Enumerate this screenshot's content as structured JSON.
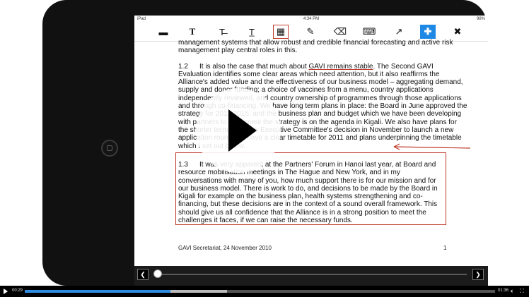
{
  "status": {
    "carrier": "iPad",
    "time": "4:34 PM",
    "battery": "98%"
  },
  "toolbar": {
    "tools": [
      {
        "name": "comment",
        "glyph": "▬",
        "icon": "comment-icon"
      },
      {
        "name": "text-box",
        "glyph": "T",
        "icon": "text-box-icon"
      },
      {
        "name": "strikethrough",
        "glyph": "T̶",
        "icon": "strikethrough-icon"
      },
      {
        "name": "underline",
        "glyph": "T̲",
        "icon": "underline-icon"
      },
      {
        "name": "highlight-box",
        "glyph": "▦",
        "icon": "highlight-box-icon"
      },
      {
        "name": "pen",
        "glyph": "✎",
        "icon": "pen-icon"
      },
      {
        "name": "eraser",
        "glyph": "⌫",
        "icon": "eraser-icon"
      },
      {
        "name": "keyboard",
        "glyph": "⌨",
        "icon": "keyboard-icon"
      },
      {
        "name": "line",
        "glyph": "↗",
        "icon": "line-arrow-icon"
      },
      {
        "name": "add",
        "glyph": "✚",
        "icon": "plus-icon"
      },
      {
        "name": "close",
        "glyph": "✖",
        "icon": "close-icon"
      }
    ]
  },
  "document": {
    "intro": "management systems that allow robust and credible financial forecasting and active risk management play central roles in this.",
    "p12_num": "1.2",
    "p12_pre": "It is also the case that much about ",
    "p12_link": "GAVI remains stable",
    "p12_rest": ".  The Second GAVI Evaluation identifies some clear areas which need attention, but it also reaffirms the Alliance's added value and the effectiveness of our business model – aggregating demand, supply and donor funding; a choice of vaccines from a menu, country applications independently reviewed, and country ownership of programmes through those applications and through co-financing.  We have long term plans in place: the Board in June approved the strategy for 2011-2015, and the business plan and budget which we have been developing with partners to implement the strategy is on the agenda in Kigali.  We also have plans for the shorter term since the Executive Committee's decision in November to launch a new application round, we have a clear timetable for 2011 and plans underpinning the timetable which I set out below.",
    "p13_num": "1.3",
    "p13_text": "It was very apparent at the Partners' Forum in Hanoi last year, at Board and resource mobilisation meetings in The Hague and New York, and in my conversations with many of you, how much support there is for our mission and for our business model. There is work to do, and decisions to be made by the Board in Kigali for example on the business plan, health systems strengthening and co-financing, but these decisions are in the context of a sound overall framework.  This should give us all confidence that the Alliance is in a strong position to meet the challenges it faces, if we can raise the necessary funds.",
    "footer_left": "GAVI Secretariat, 24 November 2010",
    "footer_page": "1"
  },
  "nav": {
    "prev": "❮",
    "next": "❯",
    "page_fraction": 0.02
  },
  "video": {
    "elapsed": "00:29",
    "duration": "01:36",
    "played_fraction": 0.31,
    "buffered_fraction": 0.43,
    "accent": "#2e8de0"
  },
  "colors": {
    "annotation_red": "#c0392b",
    "tool_blue": "#1e88e5"
  }
}
